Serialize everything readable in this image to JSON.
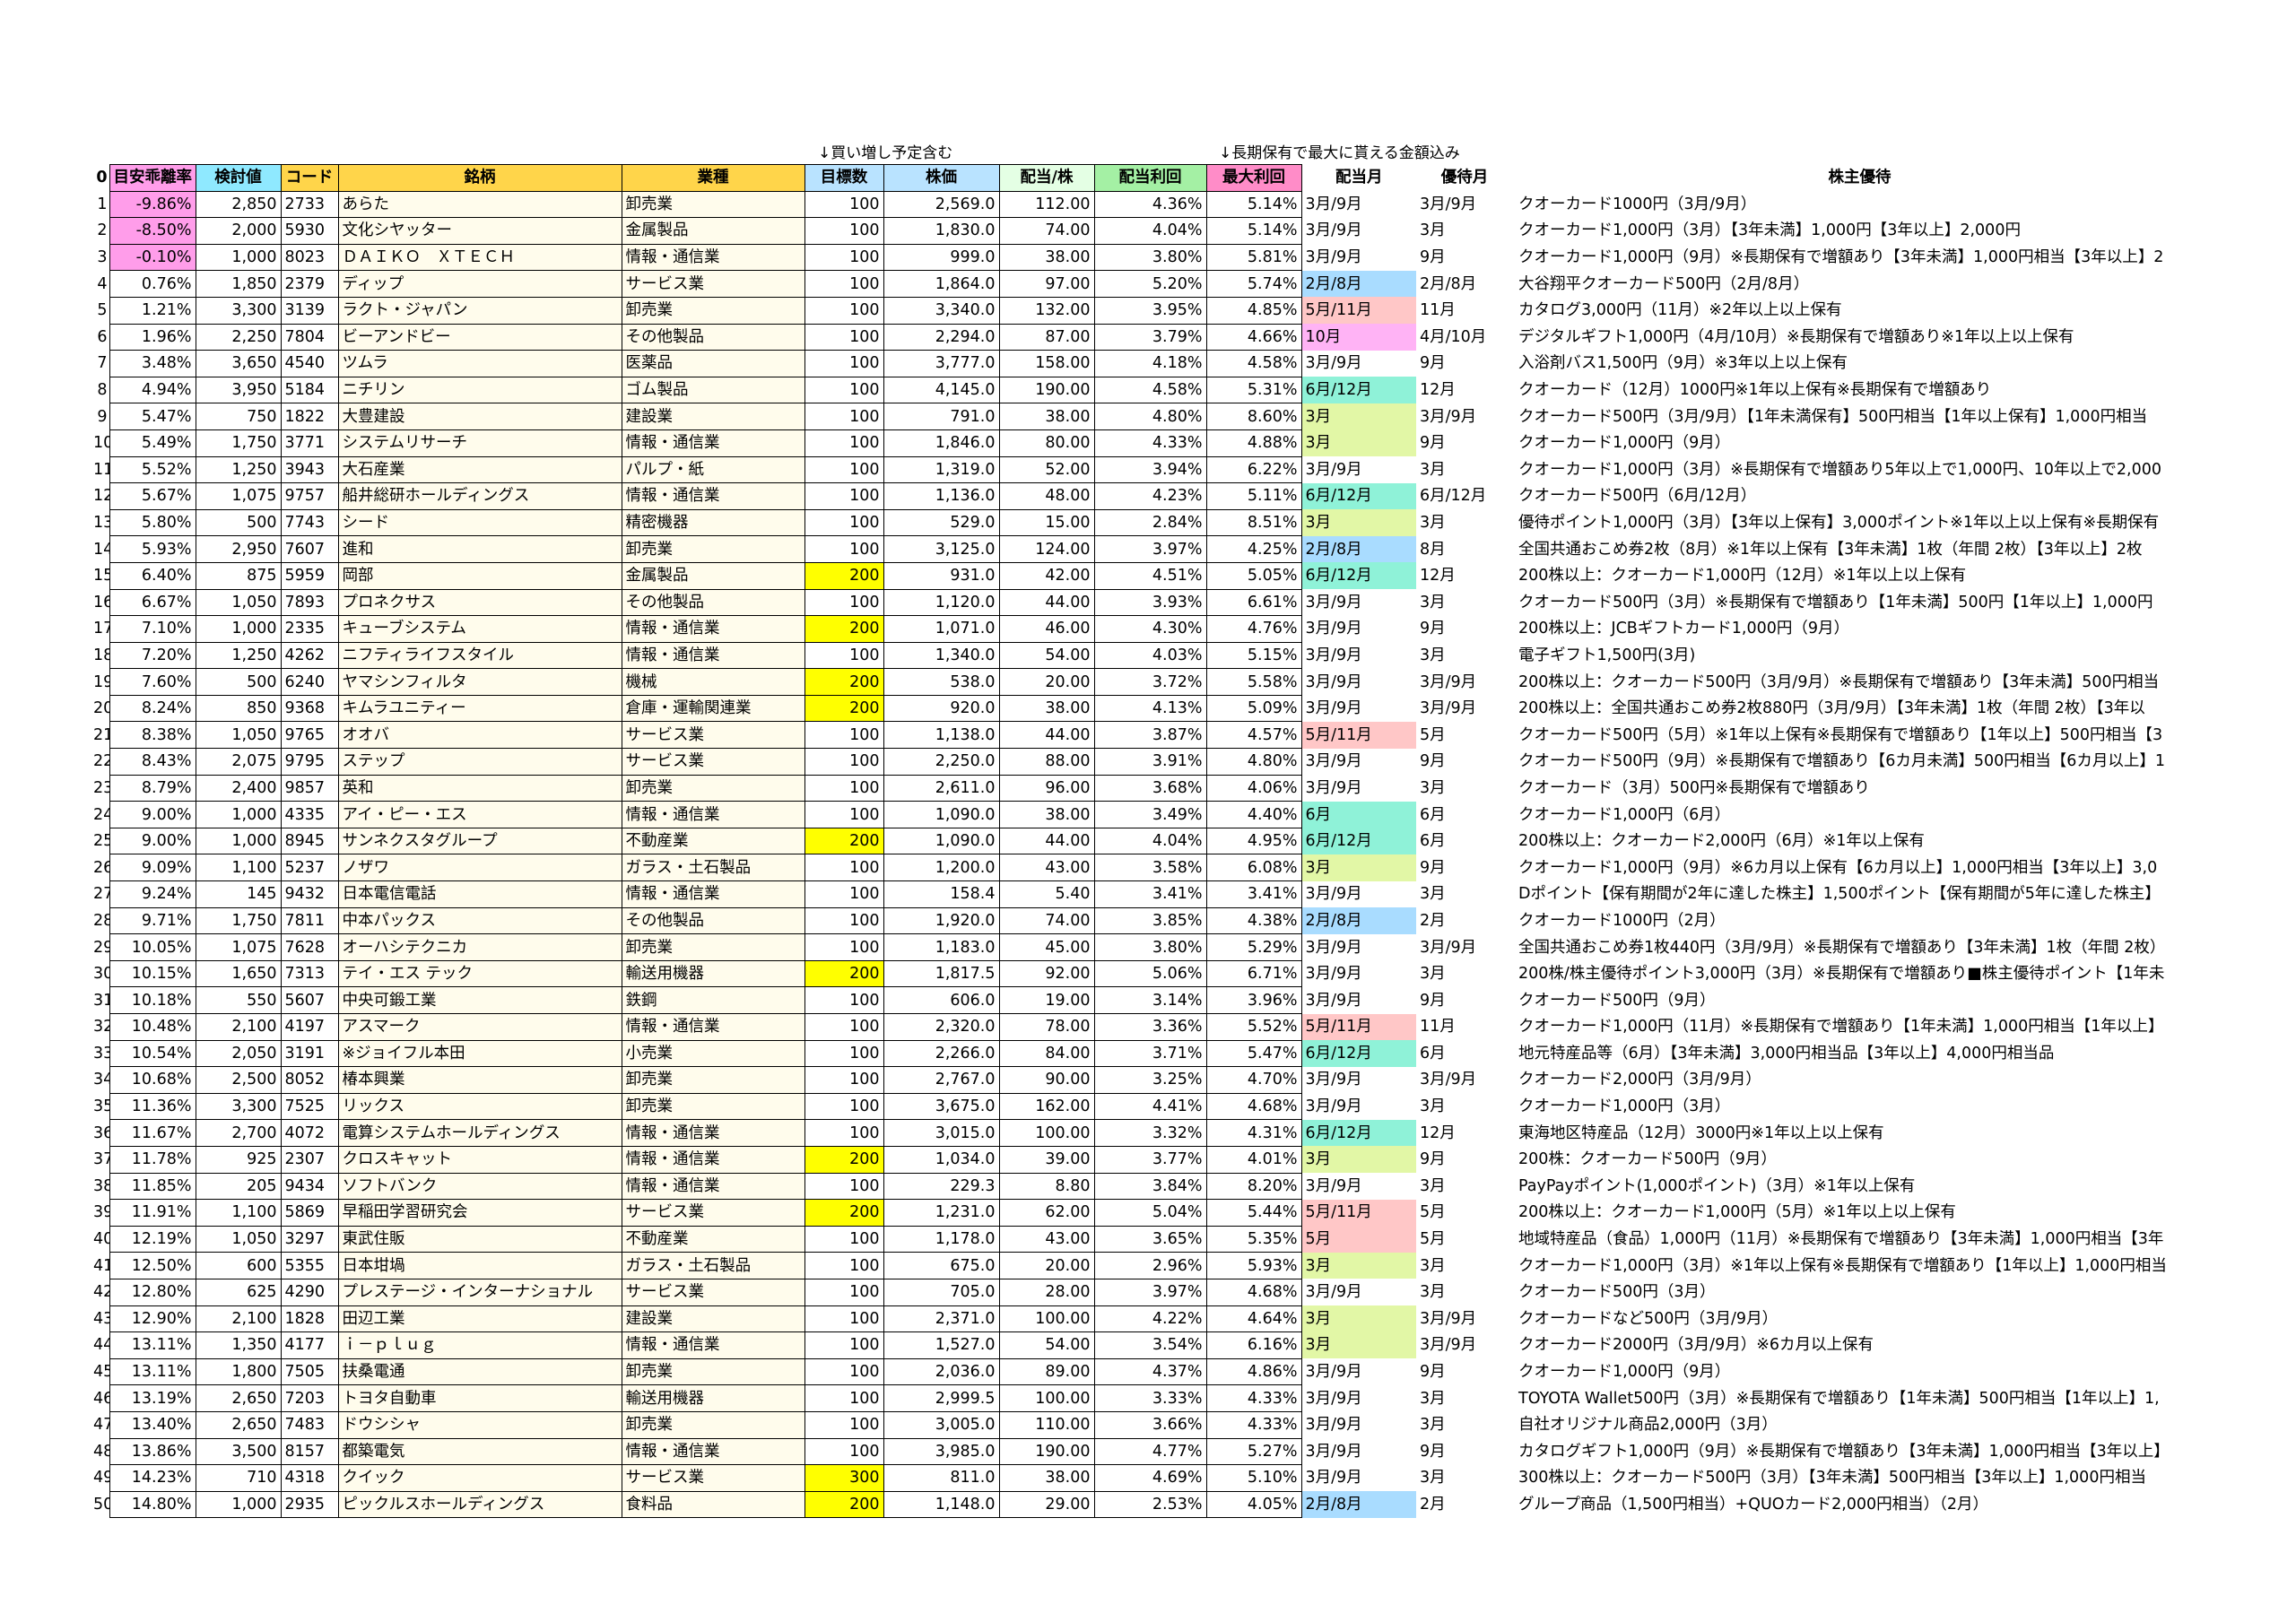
{
  "notes": {
    "buy_more": "↓買い増し予定含む",
    "long_term": "↓長期保有で最大に貰える金額込み"
  },
  "headers": {
    "index": "0",
    "deviation": "目安乖離率",
    "candidate": "検討値",
    "code": "コード",
    "name": "銘柄",
    "industry": "業種",
    "target_shares": "目標数",
    "price": "株価",
    "dividend": "配当/株",
    "yield": "配当利回",
    "max_yield": "最大利回",
    "div_month": "配当月",
    "perk_month": "優待月",
    "perk": "株主優待"
  },
  "colors": {
    "neg_deviation": "#ff9dea",
    "target_highlight": "#ffff00",
    "month_3_9": "#ffffff",
    "month_3": "#e2f7a6",
    "month_6_12": "#8ff2d8",
    "month_2_8": "#a9dcff",
    "month_5_11": "#ffc7c7",
    "month_10": "#ffb3f5",
    "month_6": "#8ff2d8",
    "month_5": "#ffc7c7"
  },
  "rows": [
    {
      "i": "1",
      "dev": "-9.86%",
      "cand": "2,850",
      "code": "2733",
      "name": "あらた",
      "ind": "卸売業",
      "target": "100",
      "price": "2,569.0",
      "div": "112.00",
      "yld": "4.36%",
      "max": "5.14%",
      "dm": "3月/9月",
      "dmc": "month_3_9",
      "pm": "3月/9月",
      "perk": "クオーカード1000円（3月/9月）"
    },
    {
      "i": "2",
      "dev": "-8.50%",
      "cand": "2,000",
      "code": "5930",
      "name": "文化シヤッター",
      "ind": "金属製品",
      "target": "100",
      "price": "1,830.0",
      "div": "74.00",
      "yld": "4.04%",
      "max": "5.14%",
      "dm": "3月/9月",
      "dmc": "month_3_9",
      "pm": "3月",
      "perk": "クオーカード1,000円（3月）【3年未満】1,000円【3年以上】2,000円"
    },
    {
      "i": "3",
      "dev": "-0.10%",
      "cand": "1,000",
      "code": "8023",
      "name": "ＤＡＩＫＯ　ＸＴＥＣＨ",
      "ind": "情報・通信業",
      "target": "100",
      "price": "999.0",
      "div": "38.00",
      "yld": "3.80%",
      "max": "5.81%",
      "dm": "3月/9月",
      "dmc": "month_3_9",
      "pm": "9月",
      "perk": "クオーカード1,000円（9月）※長期保有で増額あり【3年未満】1,000円相当【3年以上】2"
    },
    {
      "i": "4",
      "dev": "0.76%",
      "cand": "1,850",
      "code": "2379",
      "name": "ディップ",
      "ind": "サービス業",
      "target": "100",
      "price": "1,864.0",
      "div": "97.00",
      "yld": "5.20%",
      "max": "5.74%",
      "dm": "2月/8月",
      "dmc": "month_2_8",
      "pm": "2月/8月",
      "perk": "大谷翔平クオーカード500円（2月/8月）"
    },
    {
      "i": "5",
      "dev": "1.21%",
      "cand": "3,300",
      "code": "3139",
      "name": "ラクト・ジャパン",
      "ind": "卸売業",
      "target": "100",
      "price": "3,340.0",
      "div": "132.00",
      "yld": "3.95%",
      "max": "4.85%",
      "dm": "5月/11月",
      "dmc": "month_5_11",
      "pm": "11月",
      "perk": "カタログ3,000円（11月）※2年以上以上保有"
    },
    {
      "i": "6",
      "dev": "1.96%",
      "cand": "2,250",
      "code": "7804",
      "name": "ビーアンドビー",
      "ind": "その他製品",
      "target": "100",
      "price": "2,294.0",
      "div": "87.00",
      "yld": "3.79%",
      "max": "4.66%",
      "dm": "10月",
      "dmc": "month_10",
      "pm": "4月/10月",
      "perk": "デジタルギフト1,000円（4月/10月）※長期保有で増額あり※1年以上以上保有"
    },
    {
      "i": "7",
      "dev": "3.48%",
      "cand": "3,650",
      "code": "4540",
      "name": "ツムラ",
      "ind": "医薬品",
      "target": "100",
      "price": "3,777.0",
      "div": "158.00",
      "yld": "4.18%",
      "max": "4.58%",
      "dm": "3月/9月",
      "dmc": "month_3_9",
      "pm": "9月",
      "perk": "入浴剤バス1,500円（9月）※3年以上以上保有"
    },
    {
      "i": "8",
      "dev": "4.94%",
      "cand": "3,950",
      "code": "5184",
      "name": "ニチリン",
      "ind": "ゴム製品",
      "target": "100",
      "price": "4,145.0",
      "div": "190.00",
      "yld": "4.58%",
      "max": "5.31%",
      "dm": "6月/12月",
      "dmc": "month_6_12",
      "pm": "12月",
      "perk": "クオーカード（12月）1000円※1年以上保有※長期保有で増額あり"
    },
    {
      "i": "9",
      "dev": "5.47%",
      "cand": "750",
      "code": "1822",
      "name": "大豊建設",
      "ind": "建設業",
      "target": "100",
      "price": "791.0",
      "div": "38.00",
      "yld": "4.80%",
      "max": "8.60%",
      "dm": "3月",
      "dmc": "month_3",
      "pm": "3月/9月",
      "perk": "クオーカード500円（3月/9月）【1年未満保有】500円相当【1年以上保有】1,000円相当"
    },
    {
      "i": "10",
      "dev": "5.49%",
      "cand": "1,750",
      "code": "3771",
      "name": "システムリサーチ",
      "ind": "情報・通信業",
      "target": "100",
      "price": "1,846.0",
      "div": "80.00",
      "yld": "4.33%",
      "max": "4.88%",
      "dm": "3月",
      "dmc": "month_3",
      "pm": "9月",
      "perk": "クオーカード1,000円（9月）"
    },
    {
      "i": "11",
      "dev": "5.52%",
      "cand": "1,250",
      "code": "3943",
      "name": "大石産業",
      "ind": "パルプ・紙",
      "target": "100",
      "price": "1,319.0",
      "div": "52.00",
      "yld": "3.94%",
      "max": "6.22%",
      "dm": "3月/9月",
      "dmc": "month_3_9",
      "pm": "3月",
      "perk": "クオーカード1,000円（3月）※長期保有で増額あり5年以上で1,000円、10年以上で2,000"
    },
    {
      "i": "12",
      "dev": "5.67%",
      "cand": "1,075",
      "code": "9757",
      "name": "船井総研ホールディングス",
      "ind": "情報・通信業",
      "target": "100",
      "price": "1,136.0",
      "div": "48.00",
      "yld": "4.23%",
      "max": "5.11%",
      "dm": "6月/12月",
      "dmc": "month_6_12",
      "pm": "6月/12月",
      "perk": "クオーカード500円（6月/12月）"
    },
    {
      "i": "13",
      "dev": "5.80%",
      "cand": "500",
      "code": "7743",
      "name": "シード",
      "ind": "精密機器",
      "target": "100",
      "price": "529.0",
      "div": "15.00",
      "yld": "2.84%",
      "max": "8.51%",
      "dm": "3月",
      "dmc": "month_3",
      "pm": "3月",
      "perk": "優待ポイント1,000円（3月）【3年以上保有】3,000ポイント※1年以上以上保有※長期保有"
    },
    {
      "i": "14",
      "dev": "5.93%",
      "cand": "2,950",
      "code": "7607",
      "name": "進和",
      "ind": "卸売業",
      "target": "100",
      "price": "3,125.0",
      "div": "124.00",
      "yld": "3.97%",
      "max": "4.25%",
      "dm": "2月/8月",
      "dmc": "month_2_8",
      "pm": "8月",
      "perk": "全国共通おこめ券2枚（8月）※1年以上保有【3年未満】1枚（年間 2枚）【3年以上】2枚"
    },
    {
      "i": "15",
      "dev": "6.40%",
      "cand": "875",
      "code": "5959",
      "name": "岡部",
      "ind": "金属製品",
      "target": "200",
      "hl": true,
      "price": "931.0",
      "div": "42.00",
      "yld": "4.51%",
      "max": "5.05%",
      "dm": "6月/12月",
      "dmc": "month_6_12",
      "pm": "12月",
      "perk": "200株以上：クオーカード1,000円（12月）※1年以上以上保有"
    },
    {
      "i": "16",
      "dev": "6.67%",
      "cand": "1,050",
      "code": "7893",
      "name": "プロネクサス",
      "ind": "その他製品",
      "target": "100",
      "price": "1,120.0",
      "div": "44.00",
      "yld": "3.93%",
      "max": "6.61%",
      "dm": "3月/9月",
      "dmc": "month_3_9",
      "pm": "3月",
      "perk": "クオーカード500円（3月）※長期保有で増額あり【1年未満】500円【1年以上】1,000円"
    },
    {
      "i": "17",
      "dev": "7.10%",
      "cand": "1,000",
      "code": "2335",
      "name": "キューブシステム",
      "ind": "情報・通信業",
      "target": "200",
      "hl": true,
      "price": "1,071.0",
      "div": "46.00",
      "yld": "4.30%",
      "max": "4.76%",
      "dm": "3月/9月",
      "dmc": "month_3_9",
      "pm": "9月",
      "perk": "200株以上：JCBギフトカード1,000円（9月）"
    },
    {
      "i": "18",
      "dev": "7.20%",
      "cand": "1,250",
      "code": "4262",
      "name": "ニフティライフスタイル",
      "ind": "情報・通信業",
      "target": "100",
      "price": "1,340.0",
      "div": "54.00",
      "yld": "4.03%",
      "max": "5.15%",
      "dm": "3月/9月",
      "dmc": "month_3_9",
      "pm": "3月",
      "perk": "電子ギフト1,500円(3月)"
    },
    {
      "i": "19",
      "dev": "7.60%",
      "cand": "500",
      "code": "6240",
      "name": "ヤマシンフィルタ",
      "ind": "機械",
      "target": "200",
      "hl": true,
      "price": "538.0",
      "div": "20.00",
      "yld": "3.72%",
      "max": "5.58%",
      "dm": "3月/9月",
      "dmc": "month_3_9",
      "pm": "3月/9月",
      "perk": "200株以上：クオーカード500円（3月/9月）※長期保有で増額あり【3年未満】500円相当"
    },
    {
      "i": "20",
      "dev": "8.24%",
      "cand": "850",
      "code": "9368",
      "name": "キムラユニティー",
      "ind": "倉庫・運輸関連業",
      "target": "200",
      "hl": true,
      "price": "920.0",
      "div": "38.00",
      "yld": "4.13%",
      "max": "5.09%",
      "dm": "3月/9月",
      "dmc": "month_3_9",
      "pm": "3月/9月",
      "perk": "200株以上：全国共通おこめ券2枚880円（3月/9月）【3年未満】1枚（年間 2枚）【3年以"
    },
    {
      "i": "21",
      "dev": "8.38%",
      "cand": "1,050",
      "code": "9765",
      "name": "オオバ",
      "ind": "サービス業",
      "target": "100",
      "price": "1,138.0",
      "div": "44.00",
      "yld": "3.87%",
      "max": "4.57%",
      "dm": "5月/11月",
      "dmc": "month_5_11",
      "pm": "5月",
      "perk": "クオーカード500円（5月）※1年以上保有※長期保有で増額あり【1年以上】500円相当【3"
    },
    {
      "i": "22",
      "dev": "8.43%",
      "cand": "2,075",
      "code": "9795",
      "name": "ステップ",
      "ind": "サービス業",
      "target": "100",
      "price": "2,250.0",
      "div": "88.00",
      "yld": "3.91%",
      "max": "4.80%",
      "dm": "3月/9月",
      "dmc": "month_3_9",
      "pm": "9月",
      "perk": "クオーカード500円（9月）※長期保有で増額あり【6カ月未満】500円相当【6カ月以上】1"
    },
    {
      "i": "23",
      "dev": "8.79%",
      "cand": "2,400",
      "code": "9857",
      "name": "英和",
      "ind": "卸売業",
      "target": "100",
      "price": "2,611.0",
      "div": "96.00",
      "yld": "3.68%",
      "max": "4.06%",
      "dm": "3月/9月",
      "dmc": "month_3_9",
      "pm": "3月",
      "perk": "クオーカード（3月）500円※長期保有で増額あり"
    },
    {
      "i": "24",
      "dev": "9.00%",
      "cand": "1,000",
      "code": "4335",
      "name": "アイ・ピー・エス",
      "ind": "情報・通信業",
      "target": "100",
      "price": "1,090.0",
      "div": "38.00",
      "yld": "3.49%",
      "max": "4.40%",
      "dm": "6月",
      "dmc": "month_6",
      "pm": "6月",
      "perk": "クオーカード1,000円（6月）"
    },
    {
      "i": "25",
      "dev": "9.00%",
      "cand": "1,000",
      "code": "8945",
      "name": "サンネクスタグループ",
      "ind": "不動産業",
      "target": "200",
      "hl": true,
      "price": "1,090.0",
      "div": "44.00",
      "yld": "4.04%",
      "max": "4.95%",
      "dm": "6月/12月",
      "dmc": "month_6_12",
      "pm": "6月",
      "perk": "200株以上：クオーカード2,000円（6月）※1年以上保有"
    },
    {
      "i": "26",
      "dev": "9.09%",
      "cand": "1,100",
      "code": "5237",
      "name": "ノザワ",
      "ind": "ガラス・土石製品",
      "target": "100",
      "price": "1,200.0",
      "div": "43.00",
      "yld": "3.58%",
      "max": "6.08%",
      "dm": "3月",
      "dmc": "month_3",
      "pm": "9月",
      "perk": "クオーカード1,000円（9月）※6カ月以上保有【6カ月以上】1,000円相当【3年以上】3,0"
    },
    {
      "i": "27",
      "dev": "9.24%",
      "cand": "145",
      "code": "9432",
      "name": "日本電信電話",
      "ind": "情報・通信業",
      "target": "100",
      "price": "158.4",
      "div": "5.40",
      "yld": "3.41%",
      "max": "3.41%",
      "dm": "3月/9月",
      "dmc": "month_3_9",
      "pm": "3月",
      "perk": "Dポイント【保有期間が2年に達した株主】1,500ポイント【保有期間が5年に達した株主】"
    },
    {
      "i": "28",
      "dev": "9.71%",
      "cand": "1,750",
      "code": "7811",
      "name": "中本パックス",
      "ind": "その他製品",
      "target": "100",
      "price": "1,920.0",
      "div": "74.00",
      "yld": "3.85%",
      "max": "4.38%",
      "dm": "2月/8月",
      "dmc": "month_2_8",
      "pm": "2月",
      "perk": "クオーカード1000円（2月）"
    },
    {
      "i": "29",
      "dev": "10.05%",
      "cand": "1,075",
      "code": "7628",
      "name": "オーハシテクニカ",
      "ind": "卸売業",
      "target": "100",
      "price": "1,183.0",
      "div": "45.00",
      "yld": "3.80%",
      "max": "5.29%",
      "dm": "3月/9月",
      "dmc": "month_3_9",
      "pm": "3月/9月",
      "perk": "全国共通おこめ券1枚440円（3月/9月）※長期保有で増額あり【3年未満】1枚（年間 2枚）"
    },
    {
      "i": "30",
      "dev": "10.15%",
      "cand": "1,650",
      "code": "7313",
      "name": "テイ・エス テック",
      "ind": "輸送用機器",
      "target": "200",
      "hl": true,
      "price": "1,817.5",
      "div": "92.00",
      "yld": "5.06%",
      "max": "6.71%",
      "dm": "3月/9月",
      "dmc": "month_3_9",
      "pm": "3月",
      "perk": "200株/株主優待ポイント3,000円（3月）※長期保有で増額あり■株主優待ポイント【1年未"
    },
    {
      "i": "31",
      "dev": "10.18%",
      "cand": "550",
      "code": "5607",
      "name": "中央可鍛工業",
      "ind": "鉄鋼",
      "target": "100",
      "price": "606.0",
      "div": "19.00",
      "yld": "3.14%",
      "max": "3.96%",
      "dm": "3月/9月",
      "dmc": "month_3_9",
      "pm": "9月",
      "perk": "クオーカード500円（9月）"
    },
    {
      "i": "32",
      "dev": "10.48%",
      "cand": "2,100",
      "code": "4197",
      "name": "アスマーク",
      "ind": "情報・通信業",
      "target": "100",
      "price": "2,320.0",
      "div": "78.00",
      "yld": "3.36%",
      "max": "5.52%",
      "dm": "5月/11月",
      "dmc": "month_5_11",
      "pm": "11月",
      "perk": "クオーカード1,000円（11月）※長期保有で増額あり【1年未満】1,000円相当【1年以上】"
    },
    {
      "i": "33",
      "dev": "10.54%",
      "cand": "2,050",
      "code": "3191",
      "name": "※ジョイフル本田",
      "ind": "小売業",
      "target": "100",
      "price": "2,266.0",
      "div": "84.00",
      "yld": "3.71%",
      "max": "5.47%",
      "dm": "6月/12月",
      "dmc": "month_6_12",
      "pm": "6月",
      "perk": "地元特産品等（6月）【3年未満】3,000円相当品【3年以上】4,000円相当品"
    },
    {
      "i": "34",
      "dev": "10.68%",
      "cand": "2,500",
      "code": "8052",
      "name": "椿本興業",
      "ind": "卸売業",
      "target": "100",
      "price": "2,767.0",
      "div": "90.00",
      "yld": "3.25%",
      "max": "4.70%",
      "dm": "3月/9月",
      "dmc": "month_3_9",
      "pm": "3月/9月",
      "perk": "クオーカード2,000円（3月/9月）"
    },
    {
      "i": "35",
      "dev": "11.36%",
      "cand": "3,300",
      "code": "7525",
      "name": "リックス",
      "ind": "卸売業",
      "target": "100",
      "price": "3,675.0",
      "div": "162.00",
      "yld": "4.41%",
      "max": "4.68%",
      "dm": "3月/9月",
      "dmc": "month_3_9",
      "pm": "3月",
      "perk": "クオーカード1,000円（3月）"
    },
    {
      "i": "36",
      "dev": "11.67%",
      "cand": "2,700",
      "code": "4072",
      "name": "電算システムホールディングス",
      "ind": "情報・通信業",
      "target": "100",
      "price": "3,015.0",
      "div": "100.00",
      "yld": "3.32%",
      "max": "4.31%",
      "dm": "6月/12月",
      "dmc": "month_6_12",
      "pm": "12月",
      "perk": "東海地区特産品（12月）3000円※1年以上以上保有"
    },
    {
      "i": "37",
      "dev": "11.78%",
      "cand": "925",
      "code": "2307",
      "name": "クロスキャット",
      "ind": "情報・通信業",
      "target": "200",
      "hl": true,
      "price": "1,034.0",
      "div": "39.00",
      "yld": "3.77%",
      "max": "4.01%",
      "dm": "3月",
      "dmc": "month_3",
      "pm": "9月",
      "perk": "200株：クオーカード500円（9月）"
    },
    {
      "i": "38",
      "dev": "11.85%",
      "cand": "205",
      "code": "9434",
      "name": "ソフトバンク",
      "ind": "情報・通信業",
      "target": "100",
      "price": "229.3",
      "div": "8.80",
      "yld": "3.84%",
      "max": "8.20%",
      "dm": "3月/9月",
      "dmc": "month_3_9",
      "pm": "3月",
      "perk": "PayPayポイント(1,000ポイント)（3月）※1年以上保有"
    },
    {
      "i": "39",
      "dev": "11.91%",
      "cand": "1,100",
      "code": "5869",
      "name": "早稲田学習研究会",
      "ind": "サービス業",
      "target": "200",
      "hl": true,
      "price": "1,231.0",
      "div": "62.00",
      "yld": "5.04%",
      "max": "5.44%",
      "dm": "5月/11月",
      "dmc": "month_5_11",
      "pm": "5月",
      "perk": "200株以上：クオーカード1,000円（5月）※1年以上以上保有"
    },
    {
      "i": "40",
      "dev": "12.19%",
      "cand": "1,050",
      "code": "3297",
      "name": "東武住販",
      "ind": "不動産業",
      "target": "100",
      "price": "1,178.0",
      "div": "43.00",
      "yld": "3.65%",
      "max": "5.35%",
      "dm": "5月",
      "dmc": "month_5",
      "pm": "5月",
      "perk": "地域特産品（食品）1,000円（11月）※長期保有で増額あり【3年未満】1,000円相当【3年"
    },
    {
      "i": "41",
      "dev": "12.50%",
      "cand": "600",
      "code": "5355",
      "name": "日本坩堝",
      "ind": "ガラス・土石製品",
      "target": "100",
      "price": "675.0",
      "div": "20.00",
      "yld": "2.96%",
      "max": "5.93%",
      "dm": "3月",
      "dmc": "month_3",
      "pm": "3月",
      "perk": "クオーカード1,000円（3月）※1年以上保有※長期保有で増額あり【1年以上】1,000円相当"
    },
    {
      "i": "42",
      "dev": "12.80%",
      "cand": "625",
      "code": "4290",
      "name": "プレステージ・インターナショナル",
      "ind": "サービス業",
      "target": "100",
      "price": "705.0",
      "div": "28.00",
      "yld": "3.97%",
      "max": "4.68%",
      "dm": "3月/9月",
      "dmc": "month_3_9",
      "pm": "3月",
      "perk": "クオーカード500円（3月）"
    },
    {
      "i": "43",
      "dev": "12.90%",
      "cand": "2,100",
      "code": "1828",
      "name": "田辺工業",
      "ind": "建設業",
      "target": "100",
      "price": "2,371.0",
      "div": "100.00",
      "yld": "4.22%",
      "max": "4.64%",
      "dm": "3月",
      "dmc": "month_3",
      "pm": "3月/9月",
      "perk": "クオーカードなど500円（3月/9月）"
    },
    {
      "i": "44",
      "dev": "13.11%",
      "cand": "1,350",
      "code": "4177",
      "name": "ｉ－ｐｌｕｇ",
      "ind": "情報・通信業",
      "target": "100",
      "price": "1,527.0",
      "div": "54.00",
      "yld": "3.54%",
      "max": "6.16%",
      "dm": "3月",
      "dmc": "month_3",
      "pm": "3月/9月",
      "perk": "クオーカード2000円（3月/9月）※6カ月以上保有"
    },
    {
      "i": "45",
      "dev": "13.11%",
      "cand": "1,800",
      "code": "7505",
      "name": "扶桑電通",
      "ind": "卸売業",
      "target": "100",
      "price": "2,036.0",
      "div": "89.00",
      "yld": "4.37%",
      "max": "4.86%",
      "dm": "3月/9月",
      "dmc": "month_3_9",
      "pm": "9月",
      "perk": "クオーカード1,000円（9月）"
    },
    {
      "i": "46",
      "dev": "13.19%",
      "cand": "2,650",
      "code": "7203",
      "name": "トヨタ自動車",
      "ind": "輸送用機器",
      "target": "100",
      "price": "2,999.5",
      "div": "100.00",
      "yld": "3.33%",
      "max": "4.33%",
      "dm": "3月/9月",
      "dmc": "month_3_9",
      "pm": "3月",
      "perk": "TOYOTA Wallet500円（3月）※長期保有で増額あり【1年未満】500円相当【1年以上】1,"
    },
    {
      "i": "47",
      "dev": "13.40%",
      "cand": "2,650",
      "code": "7483",
      "name": "ドウシシャ",
      "ind": "卸売業",
      "target": "100",
      "price": "3,005.0",
      "div": "110.00",
      "yld": "3.66%",
      "max": "4.33%",
      "dm": "3月/9月",
      "dmc": "month_3_9",
      "pm": "3月",
      "perk": "自社オリジナル商品2,000円（3月）"
    },
    {
      "i": "48",
      "dev": "13.86%",
      "cand": "3,500",
      "code": "8157",
      "name": "都築電気",
      "ind": "情報・通信業",
      "target": "100",
      "price": "3,985.0",
      "div": "190.00",
      "yld": "4.77%",
      "max": "5.27%",
      "dm": "3月/9月",
      "dmc": "month_3_9",
      "pm": "9月",
      "perk": "カタログギフト1,000円（9月）※長期保有で増額あり【3年未満】1,000円相当【3年以上】"
    },
    {
      "i": "49",
      "dev": "14.23%",
      "cand": "710",
      "code": "4318",
      "name": "クイック",
      "ind": "サービス業",
      "target": "300",
      "hl": true,
      "price": "811.0",
      "div": "38.00",
      "yld": "4.69%",
      "max": "5.10%",
      "dm": "3月/9月",
      "dmc": "month_3_9",
      "pm": "3月",
      "perk": "300株以上：クオーカード500円（3月）【3年未満】500円相当【3年以上】1,000円相当"
    },
    {
      "i": "50",
      "dev": "14.80%",
      "cand": "1,000",
      "code": "2935",
      "name": "ピックルスホールディングス",
      "ind": "食料品",
      "target": "200",
      "hl": true,
      "price": "1,148.0",
      "div": "29.00",
      "yld": "2.53%",
      "max": "4.05%",
      "dm": "2月/8月",
      "dmc": "month_2_8",
      "pm": "2月",
      "perk": "グループ商品（1,500円相当）+QUOカード2,000円相当）（2月）"
    }
  ]
}
